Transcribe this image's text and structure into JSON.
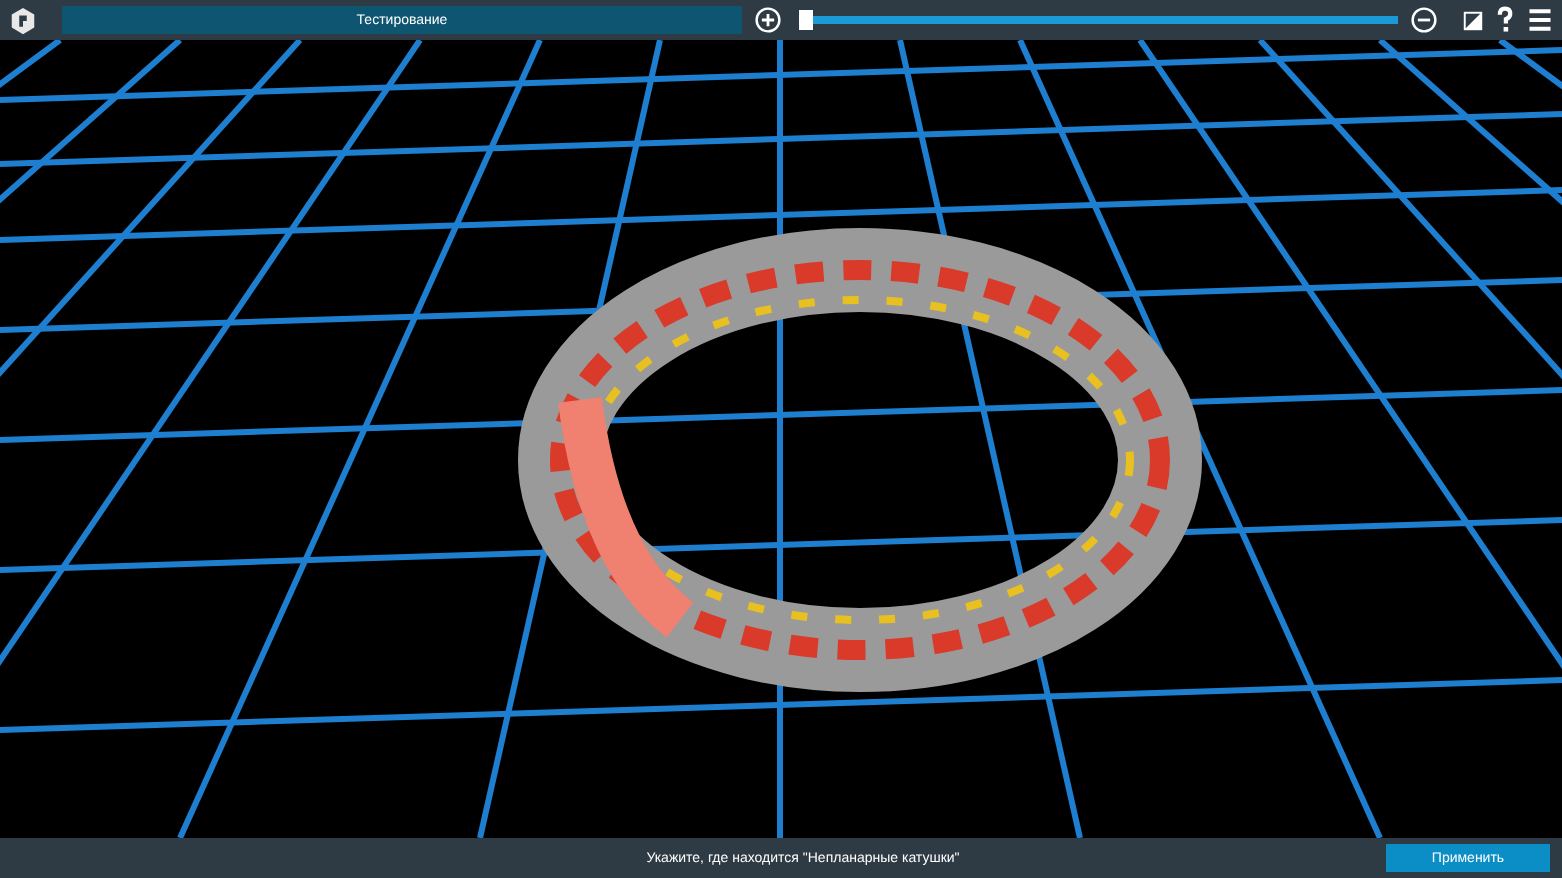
{
  "toolbar": {
    "title": "Тестирование",
    "zoom_slider": {
      "level": 0.0
    }
  },
  "footer": {
    "prompt": "Укажите, где находится \"Непланарные катушки\"",
    "apply_button": "Применить"
  }
}
